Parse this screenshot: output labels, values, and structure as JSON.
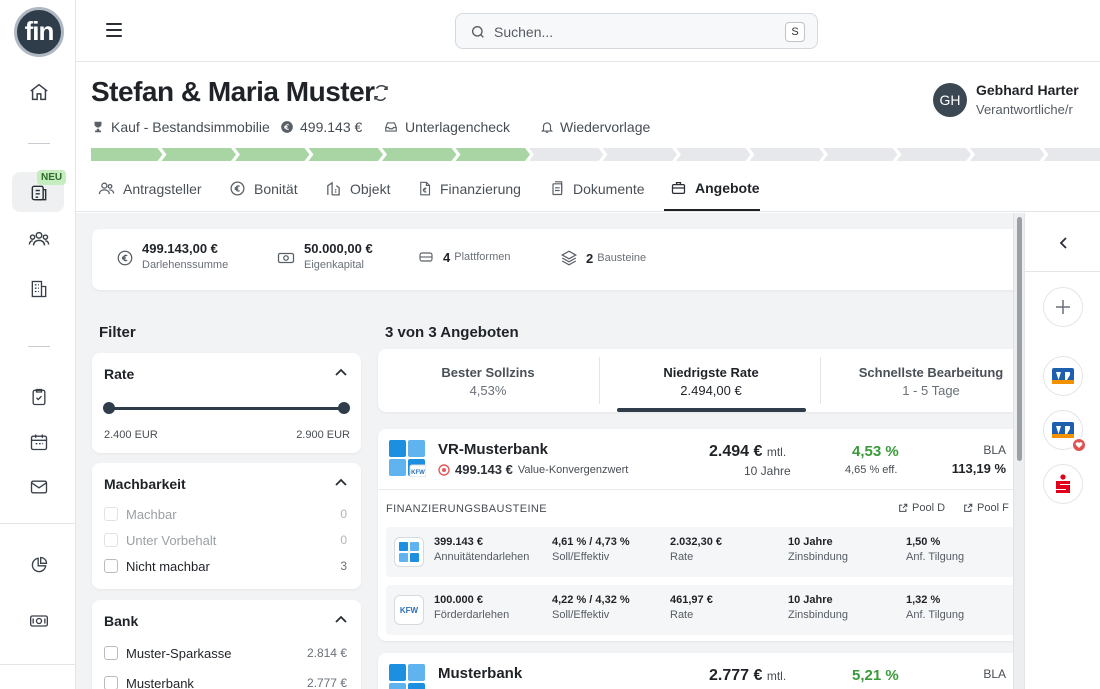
{
  "app": {
    "logo_text": "fin",
    "rail_badge": "NEU"
  },
  "search": {
    "placeholder": "Suchen...",
    "shortcut": "S"
  },
  "header": {
    "title": "Stefan & Maria Muster",
    "meta": [
      {
        "icon": "trophy-icon",
        "text": "Kauf - Bestandsimmobilie"
      },
      {
        "icon": "euro-coin-icon",
        "text": "499.143 €"
      },
      {
        "icon": "inbox-icon",
        "text": "Unterlagencheck"
      },
      {
        "icon": "bell-icon",
        "text": "Wiedervorlage"
      }
    ],
    "owner": {
      "initials": "GH",
      "name": "Gebhard Harter",
      "role": "Verantwortliche/r"
    },
    "progress": {
      "total_steps": 14,
      "completed_steps": 6,
      "done_color": "#a9d5a4",
      "todo_color": "#e6e8eb"
    }
  },
  "tabs": [
    {
      "icon": "users-icon",
      "label": "Antragsteller"
    },
    {
      "icon": "euro-circle-icon",
      "label": "Bonität"
    },
    {
      "icon": "building-icon",
      "label": "Objekt"
    },
    {
      "icon": "document-euro-icon",
      "label": "Finanzierung"
    },
    {
      "icon": "documents-icon",
      "label": "Dokumente"
    },
    {
      "icon": "briefcase-icon",
      "label": "Angebote",
      "active": true
    }
  ],
  "summary": [
    {
      "icon": "euro-circle-icon",
      "value": "499.143,00 €",
      "label": "Darlehenssumme"
    },
    {
      "icon": "cash-icon",
      "value": "50.000,00 €",
      "label": "Eigenkapital"
    },
    {
      "icon": "stack-icon",
      "value": "4",
      "label": "Plattformen"
    },
    {
      "icon": "layers-icon",
      "value": "2",
      "label": "Bausteine"
    }
  ],
  "filter": {
    "title": "Filter",
    "rate": {
      "title": "Rate",
      "min": "2.400 EUR",
      "max": "2.900 EUR"
    },
    "machbarkeit": {
      "title": "Machbarkeit",
      "items": [
        {
          "label": "Machbar",
          "count": "0",
          "disabled": true
        },
        {
          "label": "Unter Vorbehalt",
          "count": "0",
          "disabled": true
        },
        {
          "label": "Nicht machbar",
          "count": "3",
          "disabled": false
        }
      ]
    },
    "bank": {
      "title": "Bank",
      "items": [
        {
          "label": "Muster-Sparkasse",
          "count": "2.814 €"
        },
        {
          "label": "Musterbank",
          "count": "2.777 €"
        }
      ]
    }
  },
  "offers": {
    "title": "3 von 3 Angeboten",
    "sort": [
      {
        "label": "Bester Sollzins",
        "value": "4,53%"
      },
      {
        "label": "Niedrigste Rate",
        "value": "2.494,00 €",
        "active": true
      },
      {
        "label": "Schnellste Bearbeitung",
        "value": "1 - 5 Tage"
      }
    ],
    "list": [
      {
        "bank": "VR-Musterbank",
        "value": "499.143 €",
        "value_note": "Value-Konvergenzwert",
        "rate": "2.494 €",
        "rate_unit": "mtl.",
        "term": "10 Jahre",
        "zins": "4,53 %",
        "eff": "4,65 % eff.",
        "bla_label": "BLA",
        "bla": "113,19 %",
        "bausteine_label": "FINANZIERUNGSBAUSTEINE",
        "pools": [
          "Pool D",
          "Pool F"
        ],
        "bausteine": [
          {
            "logo": "vr-logo",
            "amount": "399.143 €",
            "type": "Annuitätendarlehen",
            "zins": "4,61 % / 4,73 %",
            "zins_l": "Soll/Effektiv",
            "rate": "2.032,30 €",
            "rate_l": "Rate",
            "bind": "10 Jahre",
            "bind_l": "Zinsbindung",
            "tilg": "1,50 %",
            "tilg_l": "Anf. Tilgung"
          },
          {
            "logo": "KFW",
            "amount": "100.000 €",
            "type": "Förderdarlehen",
            "zins": "4,22 % / 4,32 %",
            "zins_l": "Soll/Effektiv",
            "rate": "461,97 €",
            "rate_l": "Rate",
            "bind": "10 Jahre",
            "bind_l": "Zinsbindung",
            "tilg": "1,32 %",
            "tilg_l": "Anf. Tilgung"
          }
        ]
      },
      {
        "bank": "Musterbank",
        "rate": "2.777 €",
        "rate_unit": "mtl.",
        "zins": "5,21 %",
        "bla_label": "BLA"
      }
    ]
  },
  "colors": {
    "accent_dark": "#2f3d4a",
    "green": "#3a9a3a",
    "progress_done": "#a9d5a4",
    "vr_blue": "#1d8fe0",
    "sparkasse_red": "#e2001a"
  }
}
